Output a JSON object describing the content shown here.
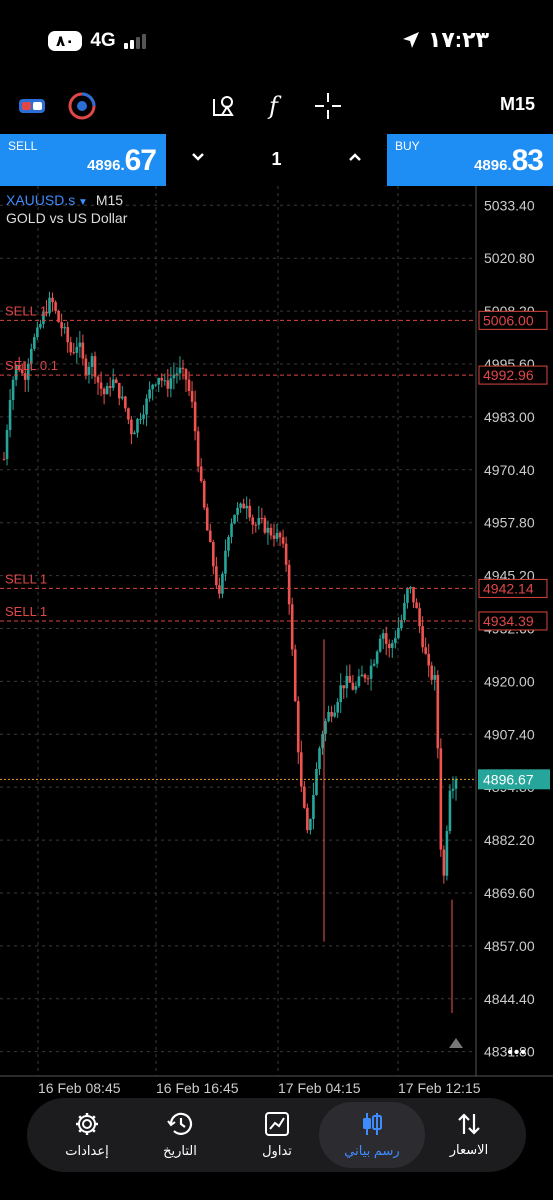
{
  "status": {
    "battery": "٨٠",
    "network": "4G",
    "time": "١٧:٢٣"
  },
  "toolbar": {
    "timeframe": "M15",
    "icons": [
      "one-click-trading-icon",
      "indicator-speed-icon",
      "objects-icon",
      "function-icon",
      "crosshair-icon"
    ]
  },
  "trade": {
    "sell": {
      "label": "SELL",
      "price_small": "4896.",
      "price_big": "67"
    },
    "buy": {
      "label": "BUY",
      "price_small": "4896.",
      "price_big": "83"
    },
    "lot": "1"
  },
  "chart_data": {
    "type": "candlestick",
    "symbol": "XAUUSD.s",
    "timeframe": "M15",
    "description": "GOLD vs US Dollar",
    "y_ticks": [
      "5033.40",
      "5020.80",
      "5008.20",
      "4995.60",
      "4983.00",
      "4970.40",
      "4957.80",
      "4945.20",
      "4932.60",
      "4920.00",
      "4907.40",
      "4894.80",
      "4882.20",
      "4869.60",
      "4857.00",
      "4844.40",
      "4831.80"
    ],
    "ylim": [
      4826,
      5038
    ],
    "x_ticks": [
      "16 Feb 08:45",
      "16 Feb 16:45",
      "17 Feb 04:15",
      "17 Feb 12:15"
    ],
    "grid": true,
    "current_price": {
      "label": "4896.67",
      "value": 4896.67,
      "color": "#26a69a"
    },
    "order_levels": [
      {
        "label": "SELL 1",
        "price": "5006.00",
        "value": 5006.0
      },
      {
        "label": "SELL 0.1",
        "price": "4992.96",
        "value": 4992.96
      },
      {
        "label": "SELL 1",
        "price": "4942.14",
        "value": 4942.14
      },
      {
        "label": "SELL 1",
        "price": "4934.39",
        "value": 4934.39
      }
    ],
    "colors": {
      "up": "#26a69a",
      "down": "#ef5350",
      "grid": "#3a3a3a",
      "axis_text": "#cccccc"
    },
    "close_path": [
      4973,
      4990,
      4996,
      4992,
      5000,
      5003,
      5008,
      5011,
      5006,
      5003,
      4998,
      5001,
      4994,
      4997,
      4991,
      4988,
      4992,
      4989,
      4985,
      4979,
      4983,
      4986,
      4991,
      4993,
      4990,
      4993,
      4994,
      4992,
      4985,
      4969,
      4957,
      4948,
      4939,
      4954,
      4960,
      4961,
      4963,
      4957,
      4958,
      4956,
      4955,
      4954,
      4947,
      4919,
      4895,
      4883,
      4895,
      4907,
      4912,
      4914,
      4919,
      4920,
      4918,
      4921,
      4922,
      4926,
      4933,
      4927,
      4931,
      4935,
      4943,
      4938,
      4930,
      4922,
      4920,
      4868,
      4895,
      4896.67
    ]
  },
  "more_label": "•••",
  "nav": [
    {
      "label": "الاسعار",
      "icon": "quotes-arrows-icon",
      "active": false
    },
    {
      "label": "رسم بياني",
      "icon": "candlestick-chart-icon",
      "active": true
    },
    {
      "label": "تداول",
      "icon": "trade-chart-icon",
      "active": false
    },
    {
      "label": "التاريخ",
      "icon": "history-clock-icon",
      "active": false
    },
    {
      "label": "إعدادات",
      "icon": "settings-gear-icon",
      "active": false
    }
  ]
}
